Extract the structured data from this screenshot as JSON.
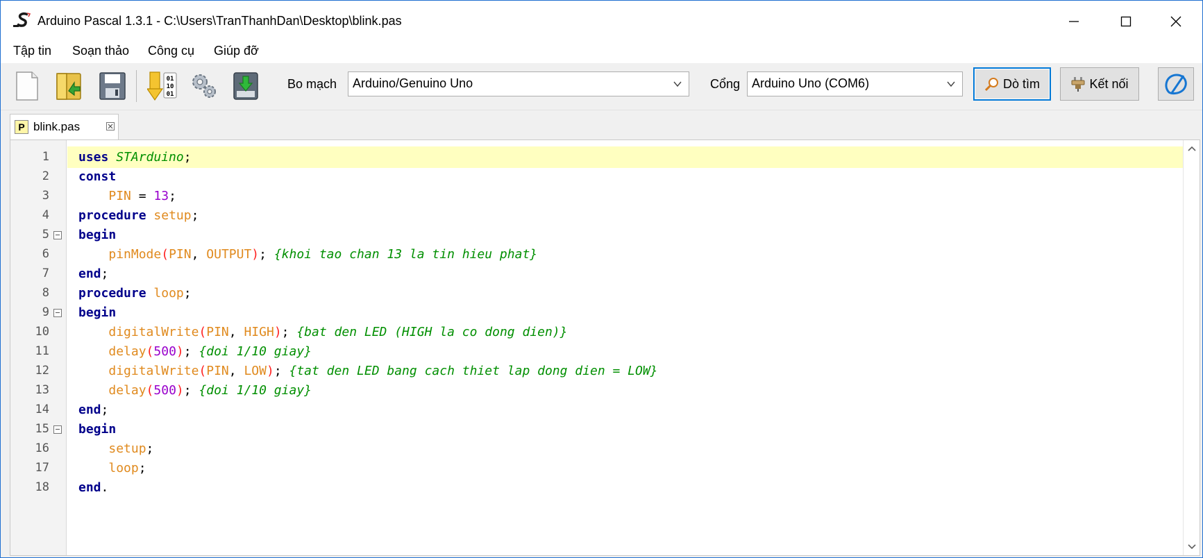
{
  "window": {
    "title": "Arduino Pascal 1.3.1 - C:\\Users\\TranThanhDan\\Desktop\\blink.pas",
    "logo_icon": "arduino-pascal-logo-icon",
    "controls": {
      "minimize_icon": "minimize-icon",
      "maximize_icon": "maximize-icon",
      "close_icon": "close-icon"
    }
  },
  "menu": {
    "items": [
      {
        "label": "Tập tin"
      },
      {
        "label": "Soạn thảo"
      },
      {
        "label": "Công cụ"
      },
      {
        "label": "Giúp đỡ"
      }
    ]
  },
  "toolbar": {
    "buttons": [
      {
        "icon": "new-file-icon"
      },
      {
        "icon": "open-folder-icon"
      },
      {
        "icon": "save-icon"
      },
      {
        "icon": "compile-icon"
      },
      {
        "icon": "settings-icon"
      },
      {
        "icon": "upload-icon"
      }
    ],
    "board_label": "Bo mạch",
    "board_value": "Arduino/Genuino Uno",
    "port_label": "Cổng",
    "port_value": "Arduino Uno (COM6)",
    "search_label": "Dò tìm",
    "search_icon": "magnifier-icon",
    "connect_label": "Kết nối",
    "connect_icon": "plug-icon",
    "serial_monitor_icon": "serial-monitor-icon"
  },
  "tab": {
    "label": "blink.pas",
    "type_badge": "P",
    "close_icon": "tab-close-icon"
  },
  "editor": {
    "current_line": 1,
    "lines": [
      {
        "n": "1",
        "tokens": [
          [
            "kw",
            "uses"
          ],
          [
            "plain",
            " "
          ],
          [
            "unit",
            "STArduino"
          ],
          [
            "plain",
            ";"
          ]
        ]
      },
      {
        "n": "2",
        "tokens": [
          [
            "kw",
            "const"
          ]
        ]
      },
      {
        "n": "3",
        "tokens": [
          [
            "plain",
            "    "
          ],
          [
            "ident",
            "PIN"
          ],
          [
            "plain",
            " = "
          ],
          [
            "num",
            "13"
          ],
          [
            "plain",
            ";"
          ]
        ]
      },
      {
        "n": "4",
        "tokens": [
          [
            "kw",
            "procedure"
          ],
          [
            "plain",
            " "
          ],
          [
            "ident",
            "setup"
          ],
          [
            "plain",
            ";"
          ]
        ]
      },
      {
        "n": "5",
        "fold": true,
        "tokens": [
          [
            "kw",
            "begin"
          ]
        ]
      },
      {
        "n": "6",
        "tokens": [
          [
            "plain",
            "    "
          ],
          [
            "ident",
            "pinMode"
          ],
          [
            "paren",
            "("
          ],
          [
            "ident",
            "PIN"
          ],
          [
            "plain",
            ", "
          ],
          [
            "ident",
            "OUTPUT"
          ],
          [
            "paren",
            ")"
          ],
          [
            "plain",
            "; "
          ],
          [
            "cmt",
            "{khoi tao chan 13 la tin hieu phat}"
          ]
        ]
      },
      {
        "n": "7",
        "tokens": [
          [
            "kw",
            "end"
          ],
          [
            "plain",
            ";"
          ]
        ]
      },
      {
        "n": "8",
        "tokens": [
          [
            "kw",
            "procedure"
          ],
          [
            "plain",
            " "
          ],
          [
            "ident",
            "loop"
          ],
          [
            "plain",
            ";"
          ]
        ]
      },
      {
        "n": "9",
        "fold": true,
        "tokens": [
          [
            "kw",
            "begin"
          ]
        ]
      },
      {
        "n": "10",
        "tokens": [
          [
            "plain",
            "    "
          ],
          [
            "ident",
            "digitalWrite"
          ],
          [
            "paren",
            "("
          ],
          [
            "ident",
            "PIN"
          ],
          [
            "plain",
            ", "
          ],
          [
            "ident",
            "HIGH"
          ],
          [
            "paren",
            ")"
          ],
          [
            "plain",
            "; "
          ],
          [
            "cmt",
            "{bat den LED (HIGH la co dong dien)}"
          ]
        ]
      },
      {
        "n": "11",
        "tokens": [
          [
            "plain",
            "    "
          ],
          [
            "ident",
            "delay"
          ],
          [
            "paren",
            "("
          ],
          [
            "num",
            "500"
          ],
          [
            "paren",
            ")"
          ],
          [
            "plain",
            "; "
          ],
          [
            "cmt",
            "{doi 1/10 giay}"
          ]
        ]
      },
      {
        "n": "12",
        "tokens": [
          [
            "plain",
            "    "
          ],
          [
            "ident",
            "digitalWrite"
          ],
          [
            "paren",
            "("
          ],
          [
            "ident",
            "PIN"
          ],
          [
            "plain",
            ", "
          ],
          [
            "ident",
            "LOW"
          ],
          [
            "paren",
            ")"
          ],
          [
            "plain",
            "; "
          ],
          [
            "cmt",
            "{tat den LED bang cach thiet lap dong dien = LOW}"
          ]
        ]
      },
      {
        "n": "13",
        "tokens": [
          [
            "plain",
            "    "
          ],
          [
            "ident",
            "delay"
          ],
          [
            "paren",
            "("
          ],
          [
            "num",
            "500"
          ],
          [
            "paren",
            ")"
          ],
          [
            "plain",
            "; "
          ],
          [
            "cmt",
            "{doi 1/10 giay}"
          ]
        ]
      },
      {
        "n": "14",
        "tokens": [
          [
            "kw",
            "end"
          ],
          [
            "plain",
            ";"
          ]
        ]
      },
      {
        "n": "15",
        "fold": true,
        "tokens": [
          [
            "kw",
            "begin"
          ]
        ]
      },
      {
        "n": "16",
        "tokens": [
          [
            "plain",
            "    "
          ],
          [
            "ident",
            "setup"
          ],
          [
            "plain",
            ";"
          ]
        ]
      },
      {
        "n": "17",
        "tokens": [
          [
            "plain",
            "    "
          ],
          [
            "ident",
            "loop"
          ],
          [
            "plain",
            ";"
          ]
        ]
      },
      {
        "n": "18",
        "tokens": [
          [
            "kw",
            "end"
          ],
          [
            "plain",
            "."
          ]
        ]
      }
    ],
    "scroll_up_icon": "scroll-up-icon",
    "scroll_down_icon": "scroll-down-icon"
  },
  "colors": {
    "keyword": "#00008b",
    "identifier": "#e08a1e",
    "comment": "#008f00",
    "number": "#9900cc",
    "paren": "#ff2020",
    "current_line": "#ffffc0",
    "accent": "#0078d7"
  }
}
